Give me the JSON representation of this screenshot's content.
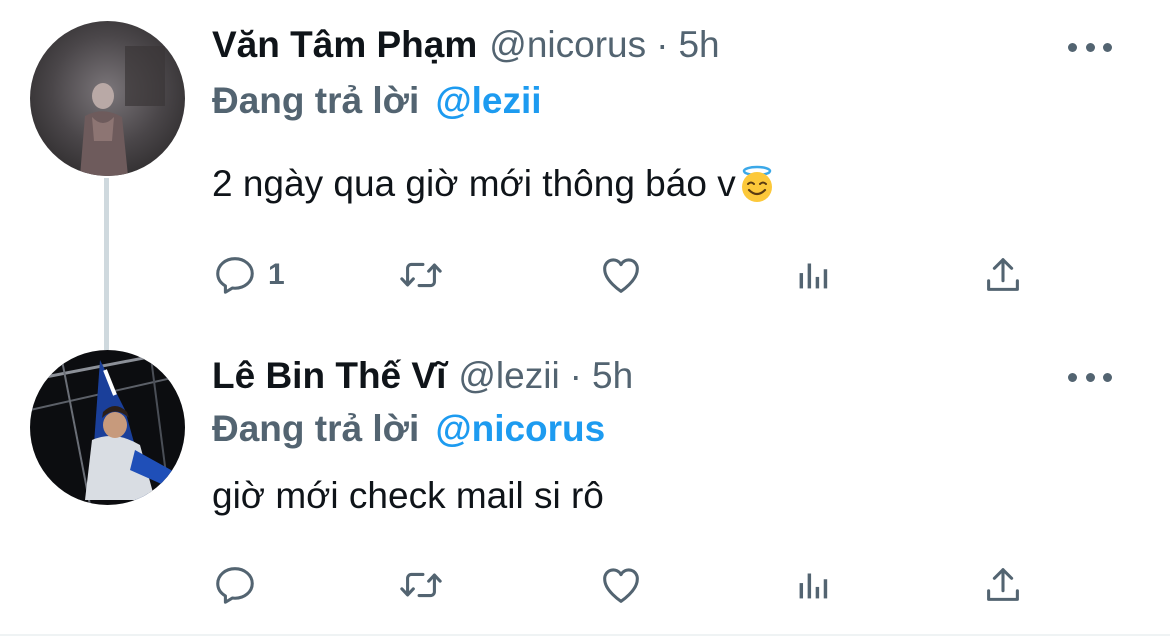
{
  "tweets": [
    {
      "author_name": "Văn Tâm Phạm",
      "handle": "@nicorus",
      "separator": "·",
      "time": "5h",
      "replying_prefix": "Đang trả lời",
      "replying_to": "@lezii",
      "text": "2 ngày qua giờ mới thông báo v",
      "emoji": "smiling-face-with-halo",
      "reply_count": "1",
      "icons": [
        "reply-icon",
        "retweet-icon",
        "like-icon",
        "views-icon",
        "share-icon",
        "more-icon"
      ]
    },
    {
      "author_name": "Lê Bin Thế Vĩ",
      "handle": "@lezii",
      "separator": "·",
      "time": "5h",
      "replying_prefix": "Đang trả lời",
      "replying_to": "@nicorus",
      "text": "giờ mới check mail si rô",
      "reply_count": "",
      "icons": [
        "reply-icon",
        "retweet-icon",
        "like-icon",
        "views-icon",
        "share-icon",
        "more-icon"
      ]
    }
  ],
  "colors": {
    "primary_text": "#0f1419",
    "secondary_text": "#536471",
    "accent": "#1d9bf0",
    "thread_line": "#cfd9de"
  }
}
